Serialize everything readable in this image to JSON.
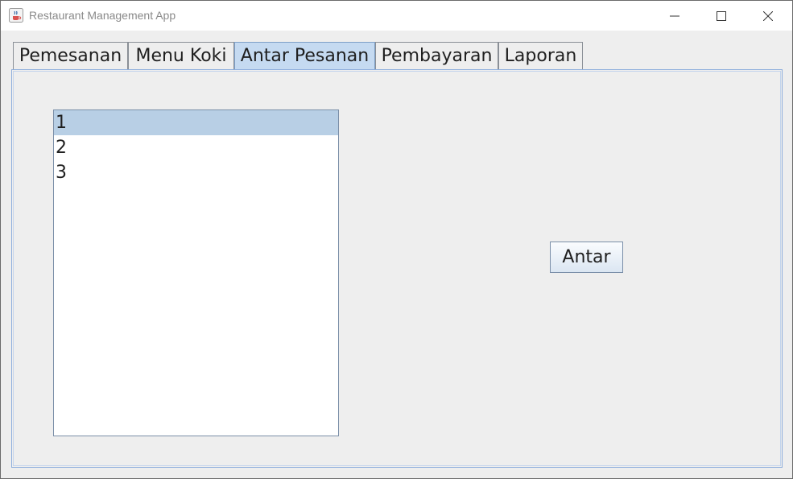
{
  "window": {
    "title": "Restaurant Management App",
    "icon": "java-cup-icon"
  },
  "tabs": [
    {
      "label": "Pemesanan",
      "active": false
    },
    {
      "label": "Menu Koki",
      "active": false
    },
    {
      "label": "Antar Pesanan",
      "active": true
    },
    {
      "label": "Pembayaran",
      "active": false
    },
    {
      "label": "Laporan",
      "active": false
    }
  ],
  "order_list": {
    "items": [
      "1",
      "2",
      "3"
    ],
    "selected_index": 0
  },
  "actions": {
    "antar_label": "Antar"
  },
  "colors": {
    "active_tab": "#c5daf1",
    "selected_row": "#b8cfe5",
    "panel_border": "#8eaedc"
  }
}
